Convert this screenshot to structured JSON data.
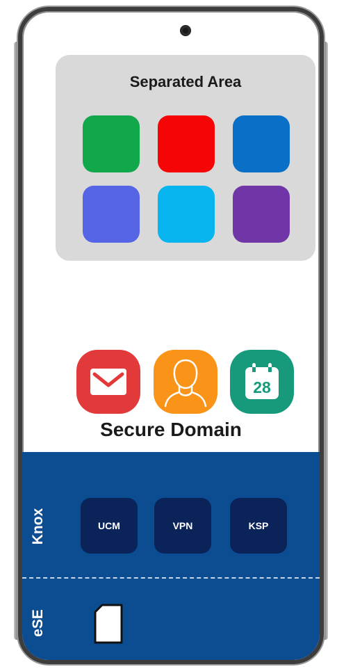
{
  "separated_area": {
    "title": "Separated Area",
    "apps": [
      {
        "color": "#10a84a"
      },
      {
        "color": "#f50505"
      },
      {
        "color": "#0a6fc7"
      },
      {
        "color": "#5664e6"
      },
      {
        "color": "#08b4ee"
      },
      {
        "color": "#7035a6"
      }
    ]
  },
  "secure_domain": {
    "title": "Secure Domain",
    "apps": [
      {
        "icon": "mail-icon",
        "color": "#e23a3a"
      },
      {
        "icon": "contact-icon",
        "color": "#f99419"
      },
      {
        "icon": "calendar-icon",
        "color": "#169a7b",
        "date": "28"
      }
    ]
  },
  "knox": {
    "label": "Knox",
    "modules": [
      "UCM",
      "VPN",
      "KSP"
    ],
    "band_color": "#0c4d92",
    "module_color": "#0a2358"
  },
  "ese": {
    "label": "eSE",
    "icon": "sim-card-icon"
  }
}
